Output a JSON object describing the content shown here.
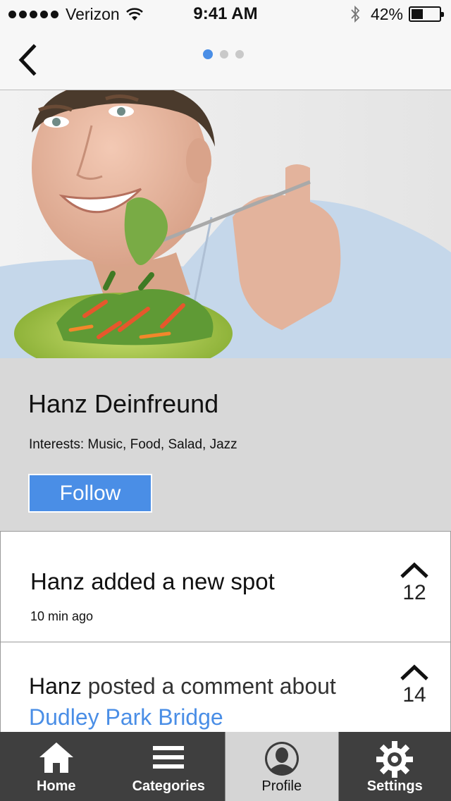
{
  "status_bar": {
    "carrier": "Verizon",
    "time": "9:41 AM",
    "battery_percent": "42%",
    "battery_level": 0.42,
    "signal_bars": 5
  },
  "nav": {
    "back_icon": "chevron-left-icon",
    "page_count": 3,
    "current_page": 1,
    "active_dot_color": "#4a8ee6",
    "inactive_dot_color": "#c9c9c9"
  },
  "profile": {
    "name": "Hanz Deinfreund",
    "interests": "Interests: Music, Food, Salad, Jazz",
    "follow_label": "Follow",
    "follow_color": "#4a8ee6"
  },
  "feed": [
    {
      "title": "Hanz added a new spot",
      "time": "10 min ago",
      "votes": "12"
    },
    {
      "actor": "Hanz",
      "action": " posted a comment about ",
      "place": "Dudley Park Bridge",
      "link_color": "#4a8ee6",
      "votes": "14"
    }
  ],
  "tabs": [
    {
      "label": "Home",
      "icon": "home-icon"
    },
    {
      "label": "Categories",
      "icon": "menu-icon"
    },
    {
      "label": "Profile",
      "icon": "profile-icon",
      "active": true
    },
    {
      "label": "Settings",
      "icon": "gear-icon"
    }
  ]
}
